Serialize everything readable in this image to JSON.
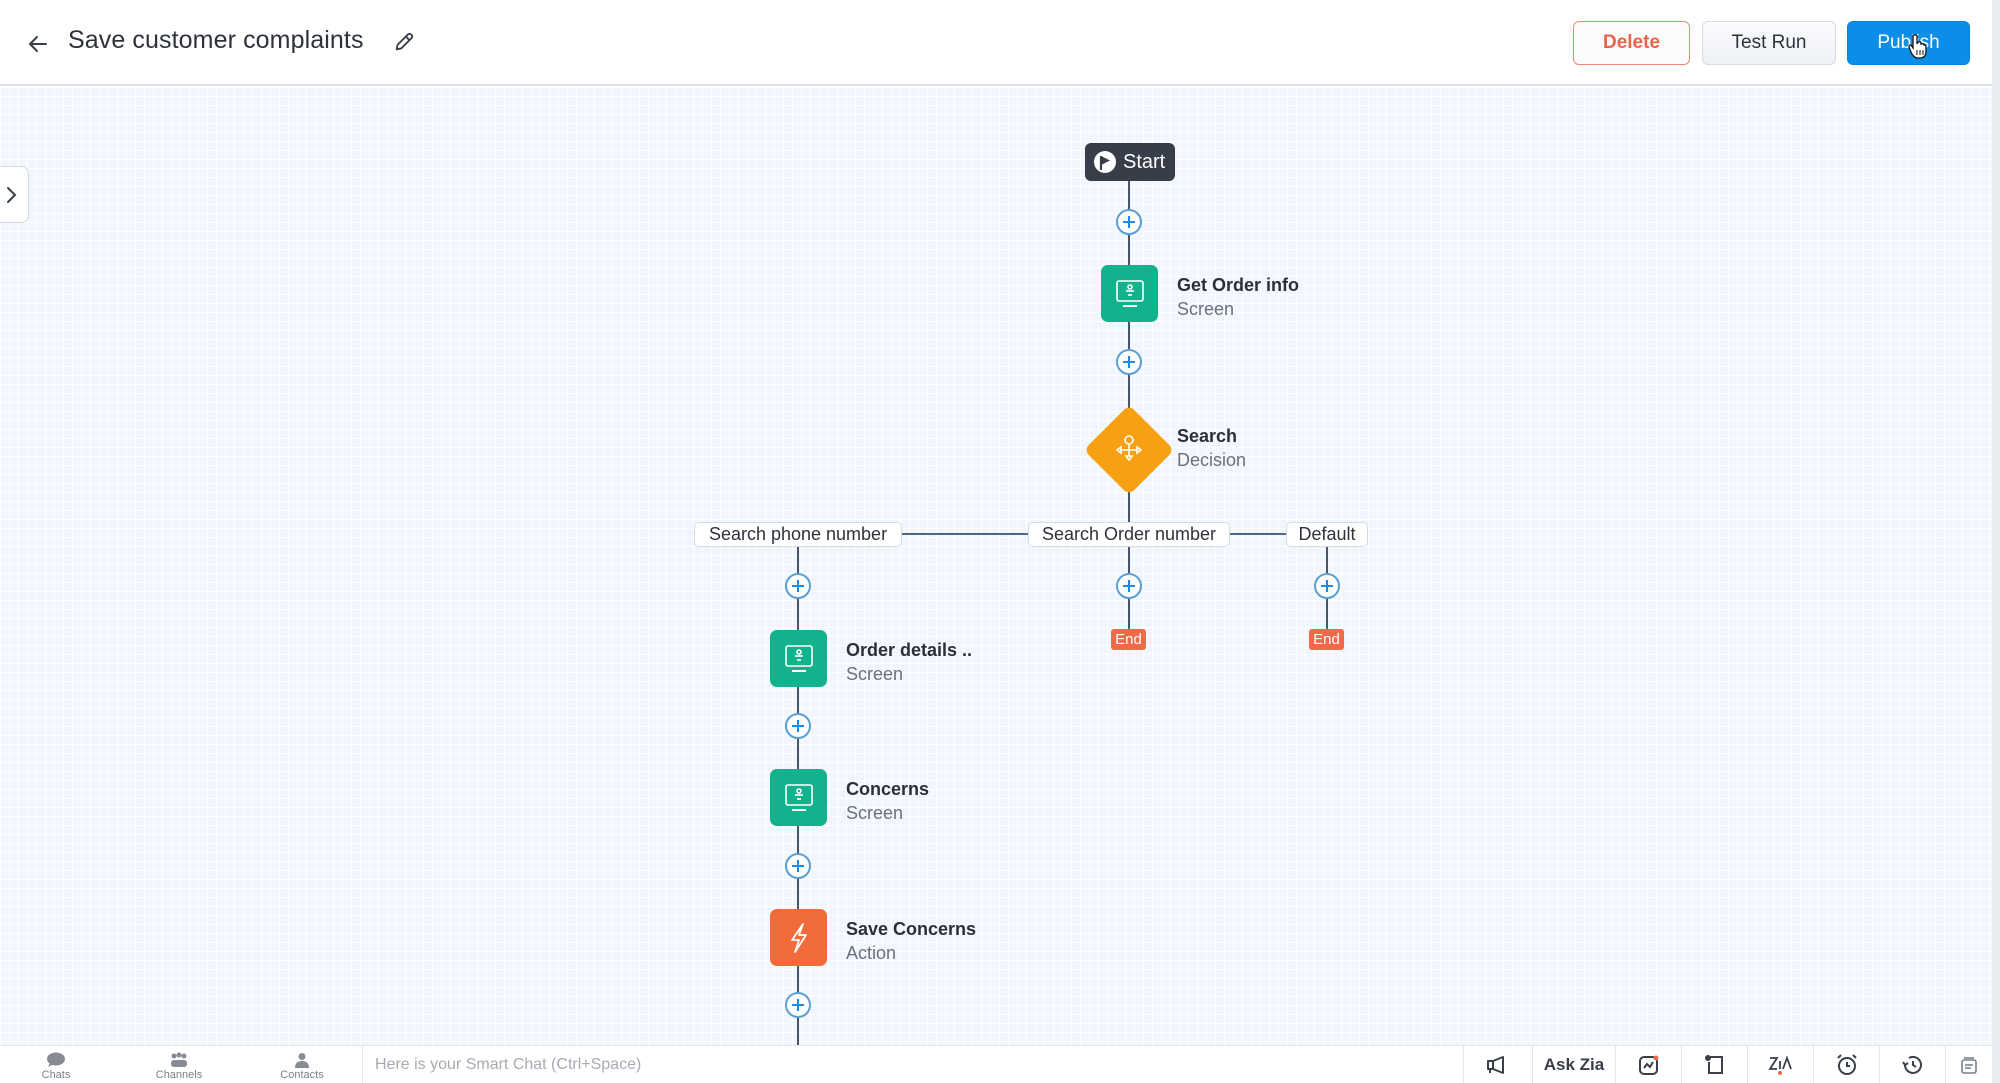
{
  "header": {
    "title": "Save customer complaints",
    "back_icon": "arrow-left-icon",
    "edit_icon": "pencil-icon",
    "buttons": {
      "delete": "Delete",
      "test_run": "Test Run",
      "publish": "Publish"
    }
  },
  "colors": {
    "publish": "#0a8ee8",
    "delete": "#e8634a",
    "screen_node": "#12b28c",
    "action_node": "#f26b3a",
    "decision_node": "#f7a011",
    "end_node": "#ef6a4b",
    "start_node": "#373d49"
  },
  "flow": {
    "start": {
      "label": "Start",
      "icon": "flag-icon"
    },
    "nodes": [
      {
        "title": "Get Order info",
        "type": "Screen",
        "icon": "screen-icon"
      },
      {
        "title": "Search",
        "type": "Decision",
        "icon": "decision-icon"
      },
      {
        "title": "Order details ..",
        "type": "Screen",
        "icon": "screen-icon"
      },
      {
        "title": "Concerns",
        "type": "Screen",
        "icon": "screen-icon"
      },
      {
        "title": "Save Concerns",
        "type": "Action",
        "icon": "lightning-icon"
      }
    ],
    "branches": [
      {
        "label": "Search phone number"
      },
      {
        "label": "Search Order number",
        "end_label": "End"
      },
      {
        "label": "Default",
        "end_label": "End"
      }
    ]
  },
  "footer": {
    "tabs": [
      {
        "label": "Chats",
        "icon": "chat-bubble-icon"
      },
      {
        "label": "Channels",
        "icon": "group-icon"
      },
      {
        "label": "Contacts",
        "icon": "person-icon"
      }
    ],
    "smart_chat_placeholder": "Here is your Smart Chat (Ctrl+Space)",
    "tools": [
      {
        "name": "announcement",
        "icon": "megaphone-icon"
      },
      {
        "name": "ask-zia",
        "label": "Ask Zia"
      },
      {
        "name": "activity",
        "icon": "activity-chart-icon"
      },
      {
        "name": "notes",
        "icon": "notes-icon"
      },
      {
        "name": "zia-translate",
        "icon": "zia-icon"
      },
      {
        "name": "reminders",
        "icon": "alarm-clock-icon"
      },
      {
        "name": "history",
        "icon": "history-icon"
      },
      {
        "name": "more",
        "icon": "stack-icon"
      }
    ]
  }
}
